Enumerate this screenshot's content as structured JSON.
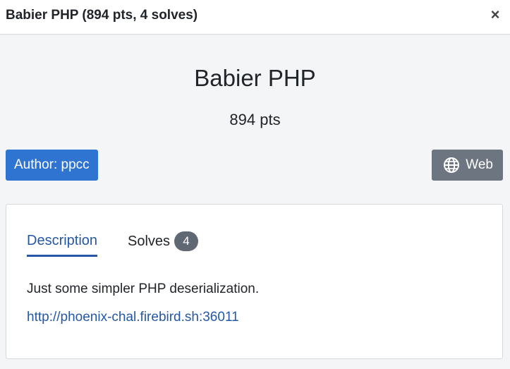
{
  "modal": {
    "title": "Babier PHP (894 pts, 4 solves)",
    "close_label": "×"
  },
  "challenge": {
    "name": "Babier PHP",
    "points": "894 pts",
    "author": "Author: ppcc",
    "category": "Web",
    "category_icon": "globe-icon"
  },
  "tabs": [
    {
      "label": "Description",
      "active": true
    },
    {
      "label": "Solves",
      "count": "4",
      "active": false
    }
  ],
  "description": {
    "text": "Just some simpler PHP deserialization.",
    "link": "http://phoenix-chal.firebird.sh:36011"
  },
  "colors": {
    "accent": "#2458a6",
    "author_badge": "#2f74d0",
    "category_badge": "#6c7580",
    "count_badge": "#5f6873"
  }
}
